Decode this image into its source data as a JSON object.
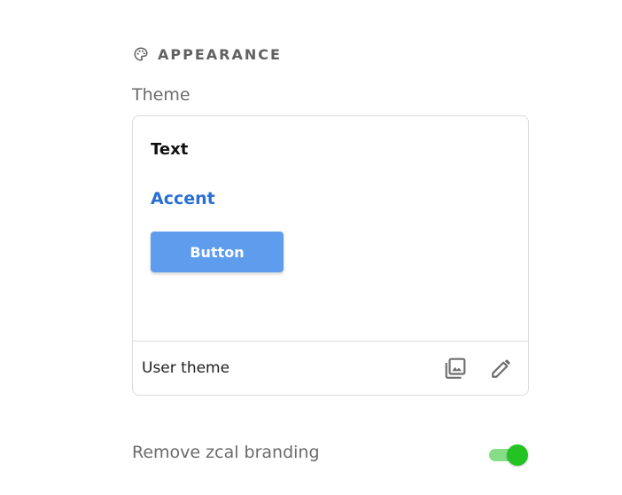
{
  "section": {
    "title": "APPEARANCE",
    "icon": "palette-icon"
  },
  "theme": {
    "label": "Theme",
    "preview": {
      "text_sample": "Text",
      "accent_sample": "Accent",
      "button_label": "Button"
    },
    "footer": {
      "label": "User theme",
      "gallery_icon": "image-gallery-icon",
      "edit_icon": "pencil-icon"
    }
  },
  "branding": {
    "label": "Remove zcal branding",
    "toggle_on": true
  },
  "colors": {
    "accent": "#2a6fd6",
    "button_bg": "#5e9cee",
    "toggle_knob": "#22c322",
    "toggle_track": "#86dd86",
    "muted_text": "#6b6b6b"
  }
}
